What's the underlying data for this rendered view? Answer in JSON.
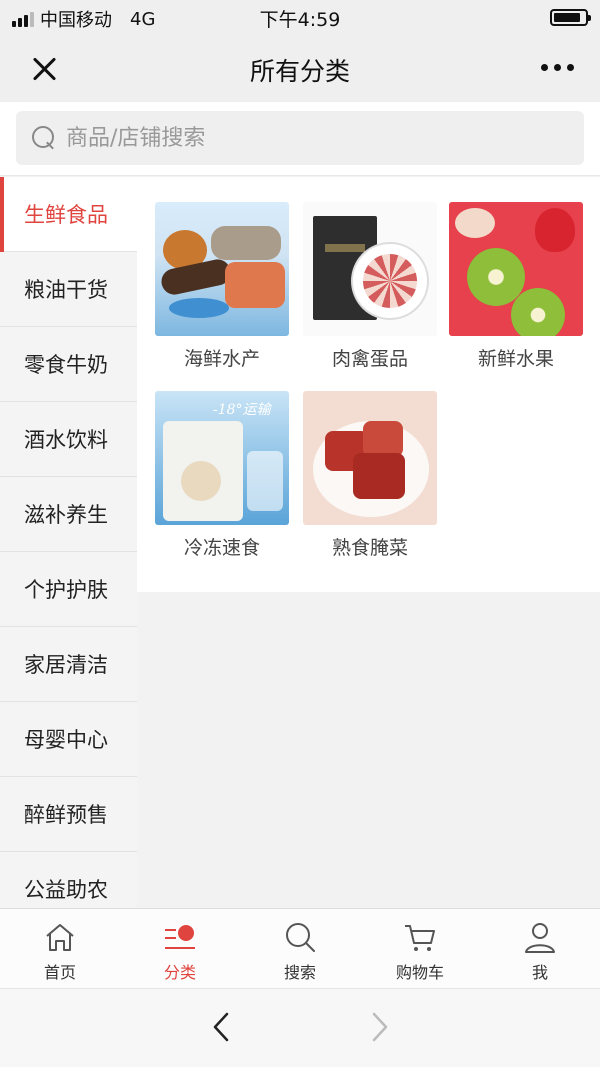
{
  "status_bar": {
    "carrier": "中国移动",
    "network": "4G",
    "time": "下午4:59",
    "battery_level": 0.85
  },
  "nav": {
    "title": "所有分类"
  },
  "search": {
    "placeholder": "商品/店铺搜索"
  },
  "sidebar": {
    "active_index": 0,
    "items": [
      {
        "label": "生鲜食品"
      },
      {
        "label": "粮油干货"
      },
      {
        "label": "零食牛奶"
      },
      {
        "label": "酒水饮料"
      },
      {
        "label": "滋补养生"
      },
      {
        "label": "个护护肤"
      },
      {
        "label": "家居清洁"
      },
      {
        "label": "母婴中心"
      },
      {
        "label": "醉鲜预售"
      },
      {
        "label": "公益助农"
      }
    ]
  },
  "categories": [
    {
      "label": "海鲜水产"
    },
    {
      "label": "肉禽蛋品"
    },
    {
      "label": "新鲜水果"
    },
    {
      "label": "冷冻速食",
      "image_text": "-18°运输"
    },
    {
      "label": "熟食腌菜"
    }
  ],
  "tabs": [
    {
      "label": "首页",
      "icon": "home-icon"
    },
    {
      "label": "分类",
      "icon": "category-icon"
    },
    {
      "label": "搜索",
      "icon": "search-icon"
    },
    {
      "label": "购物车",
      "icon": "cart-icon"
    },
    {
      "label": "我",
      "icon": "user-icon"
    }
  ],
  "active_tab": 1,
  "colors": {
    "accent": "#e0443f",
    "text": "#222222",
    "inactive_forward": "#bbbbbb"
  }
}
